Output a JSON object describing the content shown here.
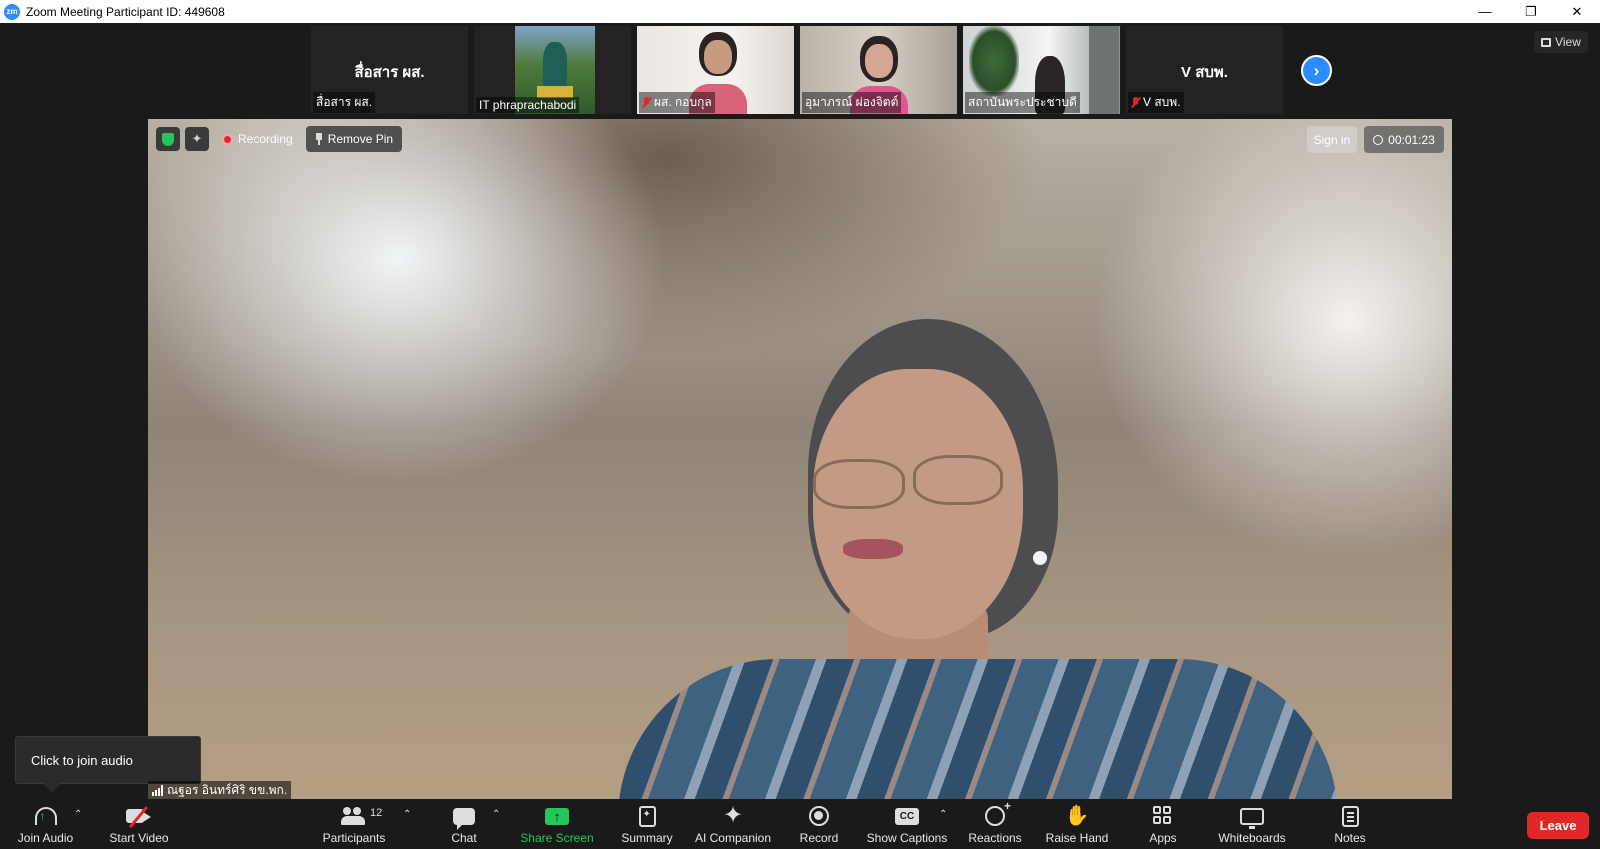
{
  "window": {
    "title": "Zoom Meeting Participant ID: 449608",
    "logo_text": "zm"
  },
  "strip": {
    "view_label": "View",
    "thumbnails": [
      {
        "display_name": "สื่อสาร ผส.",
        "label": "สื่อสาร ผส.",
        "muted": false
      },
      {
        "display_name": "",
        "label": "IT phraprachabodi",
        "muted": false
      },
      {
        "display_name": "",
        "label": "ผส. กอบกุล",
        "muted": true
      },
      {
        "display_name": "",
        "label": "อุมาภรณ์ ผ่องจิตต์",
        "muted": false
      },
      {
        "display_name": "",
        "label": "สถาบันพระประชาบดี",
        "muted": false
      },
      {
        "display_name": "V สบพ.",
        "label": "V สบพ.",
        "muted": true
      }
    ]
  },
  "main": {
    "recording_label": "Recording",
    "remove_pin_label": "Remove Pin",
    "sign_in_label": "Sign in",
    "timer": "00:01:23",
    "speaker_name": "ณฐอร อินทร์ศิริ ขข.พก.",
    "tooltip": "Click to join audio"
  },
  "toolbar": {
    "join_audio": "Join Audio",
    "start_video": "Start Video",
    "participants": "Participants",
    "participants_count": "12",
    "chat": "Chat",
    "share_screen": "Share Screen",
    "summary": "Summary",
    "ai_companion": "AI Companion",
    "record": "Record",
    "show_captions": "Show Captions",
    "cc_text": "CC",
    "reactions": "Reactions",
    "raise_hand": "Raise Hand",
    "apps": "Apps",
    "whiteboards": "Whiteboards",
    "notes": "Notes",
    "leave": "Leave"
  },
  "colors": {
    "accent_blue": "#2d8cff",
    "share_green": "#23c65a",
    "leave_red": "#e02828",
    "background": "#1a1a1a"
  }
}
